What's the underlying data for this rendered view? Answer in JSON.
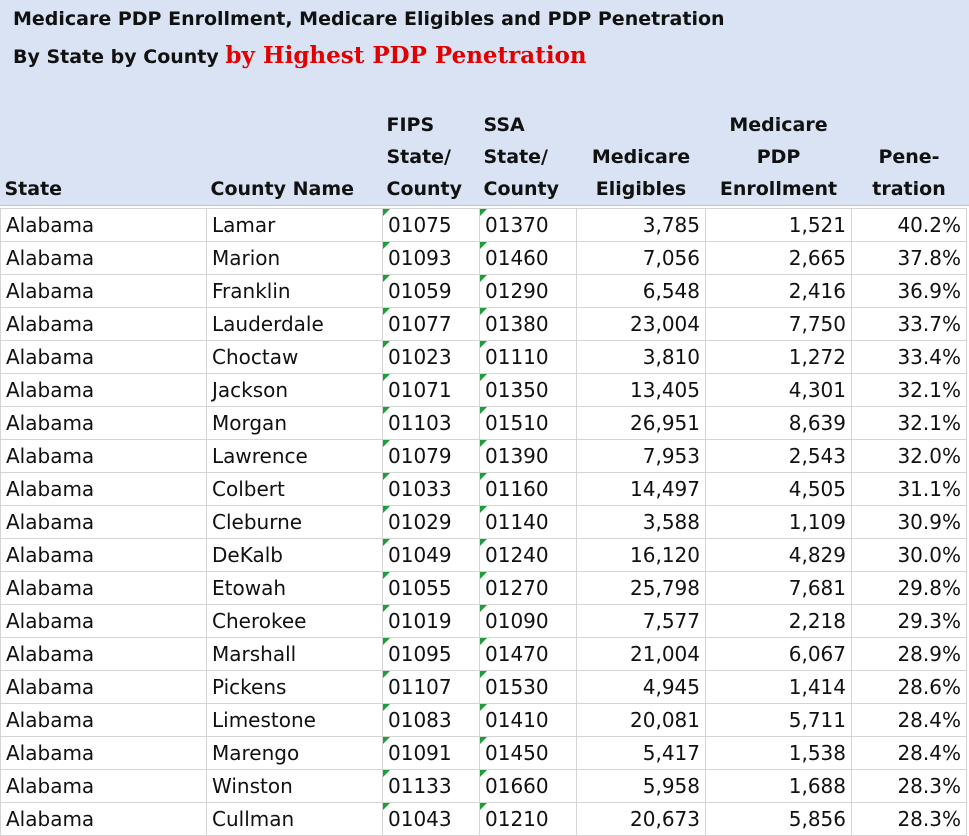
{
  "title": {
    "line1": "Medicare PDP Enrollment, Medicare Eligibles and PDP Penetration",
    "line2_prefix": "By State by County",
    "line2_highlight": "by Highest PDP Penetration"
  },
  "columns": {
    "state": "State",
    "county": "County Name",
    "fips": [
      "FIPS",
      "State/",
      "County"
    ],
    "ssa": [
      "SSA",
      "State/",
      "County"
    ],
    "eligibles": [
      "Medicare",
      "Eligibles"
    ],
    "enrollment": [
      "Medicare",
      "PDP",
      "Enrollment"
    ],
    "penetration": [
      "Pene-",
      "tration"
    ]
  },
  "rows": [
    {
      "state": "Alabama",
      "county": "Lamar",
      "fips": "01075",
      "ssa": "01370",
      "eligibles": "3,785",
      "enrollment": "1,521",
      "penetration": "40.2%"
    },
    {
      "state": "Alabama",
      "county": "Marion",
      "fips": "01093",
      "ssa": "01460",
      "eligibles": "7,056",
      "enrollment": "2,665",
      "penetration": "37.8%"
    },
    {
      "state": "Alabama",
      "county": "Franklin",
      "fips": "01059",
      "ssa": "01290",
      "eligibles": "6,548",
      "enrollment": "2,416",
      "penetration": "36.9%"
    },
    {
      "state": "Alabama",
      "county": "Lauderdale",
      "fips": "01077",
      "ssa": "01380",
      "eligibles": "23,004",
      "enrollment": "7,750",
      "penetration": "33.7%"
    },
    {
      "state": "Alabama",
      "county": "Choctaw",
      "fips": "01023",
      "ssa": "01110",
      "eligibles": "3,810",
      "enrollment": "1,272",
      "penetration": "33.4%"
    },
    {
      "state": "Alabama",
      "county": "Jackson",
      "fips": "01071",
      "ssa": "01350",
      "eligibles": "13,405",
      "enrollment": "4,301",
      "penetration": "32.1%"
    },
    {
      "state": "Alabama",
      "county": "Morgan",
      "fips": "01103",
      "ssa": "01510",
      "eligibles": "26,951",
      "enrollment": "8,639",
      "penetration": "32.1%"
    },
    {
      "state": "Alabama",
      "county": "Lawrence",
      "fips": "01079",
      "ssa": "01390",
      "eligibles": "7,953",
      "enrollment": "2,543",
      "penetration": "32.0%"
    },
    {
      "state": "Alabama",
      "county": "Colbert",
      "fips": "01033",
      "ssa": "01160",
      "eligibles": "14,497",
      "enrollment": "4,505",
      "penetration": "31.1%"
    },
    {
      "state": "Alabama",
      "county": "Cleburne",
      "fips": "01029",
      "ssa": "01140",
      "eligibles": "3,588",
      "enrollment": "1,109",
      "penetration": "30.9%"
    },
    {
      "state": "Alabama",
      "county": "DeKalb",
      "fips": "01049",
      "ssa": "01240",
      "eligibles": "16,120",
      "enrollment": "4,829",
      "penetration": "30.0%"
    },
    {
      "state": "Alabama",
      "county": "Etowah",
      "fips": "01055",
      "ssa": "01270",
      "eligibles": "25,798",
      "enrollment": "7,681",
      "penetration": "29.8%"
    },
    {
      "state": "Alabama",
      "county": "Cherokee",
      "fips": "01019",
      "ssa": "01090",
      "eligibles": "7,577",
      "enrollment": "2,218",
      "penetration": "29.3%"
    },
    {
      "state": "Alabama",
      "county": "Marshall",
      "fips": "01095",
      "ssa": "01470",
      "eligibles": "21,004",
      "enrollment": "6,067",
      "penetration": "28.9%"
    },
    {
      "state": "Alabama",
      "county": "Pickens",
      "fips": "01107",
      "ssa": "01530",
      "eligibles": "4,945",
      "enrollment": "1,414",
      "penetration": "28.6%"
    },
    {
      "state": "Alabama",
      "county": "Limestone",
      "fips": "01083",
      "ssa": "01410",
      "eligibles": "20,081",
      "enrollment": "5,711",
      "penetration": "28.4%"
    },
    {
      "state": "Alabama",
      "county": "Marengo",
      "fips": "01091",
      "ssa": "01450",
      "eligibles": "5,417",
      "enrollment": "1,538",
      "penetration": "28.4%"
    },
    {
      "state": "Alabama",
      "county": "Winston",
      "fips": "01133",
      "ssa": "01660",
      "eligibles": "5,958",
      "enrollment": "1,688",
      "penetration": "28.3%"
    },
    {
      "state": "Alabama",
      "county": "Cullman",
      "fips": "01043",
      "ssa": "01210",
      "eligibles": "20,673",
      "enrollment": "5,856",
      "penetration": "28.3%"
    }
  ],
  "colors": {
    "header_band": "#dae3f3",
    "highlight_text": "#e00000",
    "error_flag": "#1e9e3a",
    "gridline": "#d4d4d4"
  },
  "icons": {
    "cell_flag": "green-triangle-error-indicator"
  }
}
